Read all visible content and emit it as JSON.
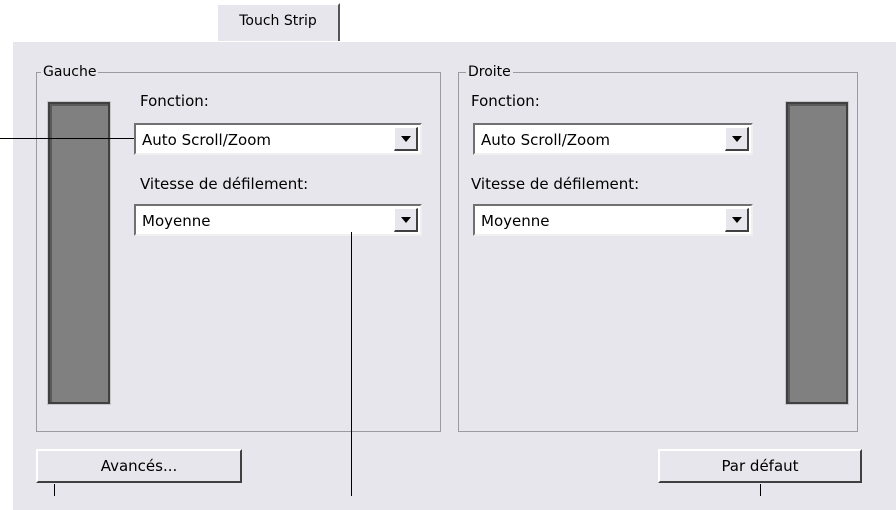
{
  "tab": {
    "label": "Touch Strip"
  },
  "left": {
    "group_label": "Gauche",
    "function_label": "Fonction:",
    "function_value": "Auto Scroll/Zoom",
    "speed_label": "Vitesse de défilement:",
    "speed_value": "Moyenne"
  },
  "right": {
    "group_label": "Droite",
    "function_label": "Fonction:",
    "function_value": "Auto Scroll/Zoom",
    "speed_label": "Vitesse de défilement:",
    "speed_value": "Moyenne"
  },
  "buttons": {
    "advanced": "Avancés...",
    "default": "Par défaut"
  },
  "colors": {
    "panel": "#e6e6ec",
    "strip": "#808080"
  }
}
